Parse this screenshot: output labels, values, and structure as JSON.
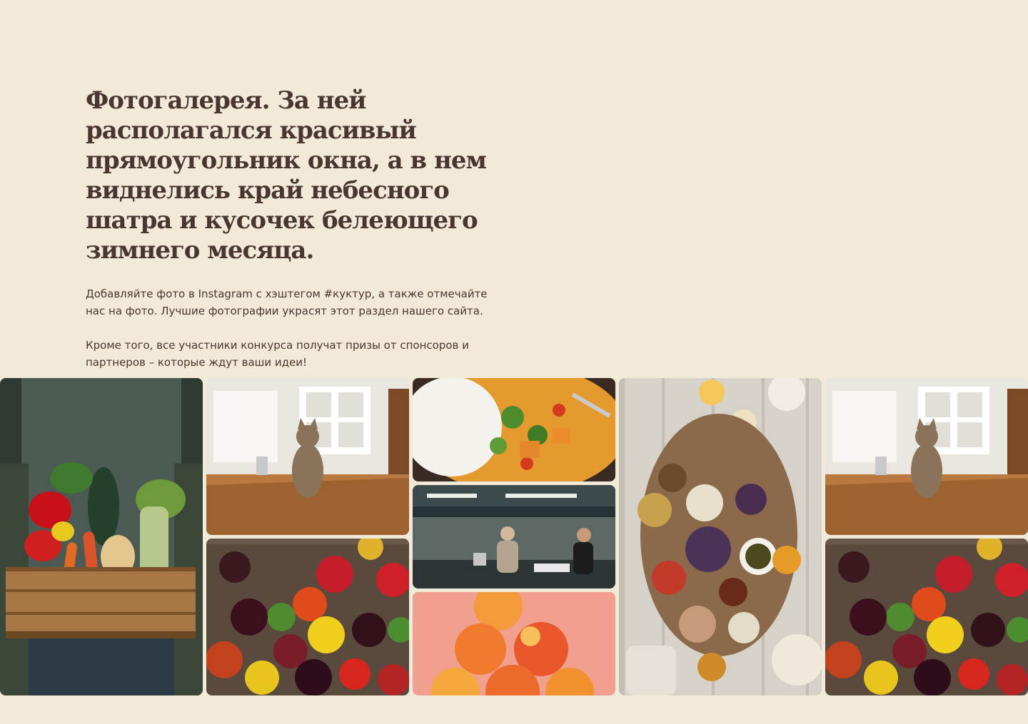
{
  "intro": {
    "title": "Фотогалерея. За ней располагался красивый прямоугольник окна, а в нем виднелись край небесного шатра и кусочек белеющего зимнего месяца.",
    "paragraph_1": "Добавляйте фото в Instagram с хэштегом #куктур, а также отмечайте нас на фото. Лучшие фотографии украсят этот раздел нашего сайта.",
    "paragraph_2": "Кроме того, все участники конкурса получат призы от спонсоров и партнеров – которые ждут ваши идеи!"
  },
  "gallery": {
    "photos": [
      {
        "subject": "vegetable-crate"
      },
      {
        "subject": "cat-on-table"
      },
      {
        "subject": "tomatoes"
      },
      {
        "subject": "rice-curry"
      },
      {
        "subject": "kitchen-chefs"
      },
      {
        "subject": "peaches"
      },
      {
        "subject": "food-board"
      },
      {
        "subject": "cat-on-table"
      },
      {
        "subject": "tomatoes"
      }
    ]
  },
  "colors": {
    "background": "#f2ead8",
    "text": "#4a3630"
  }
}
